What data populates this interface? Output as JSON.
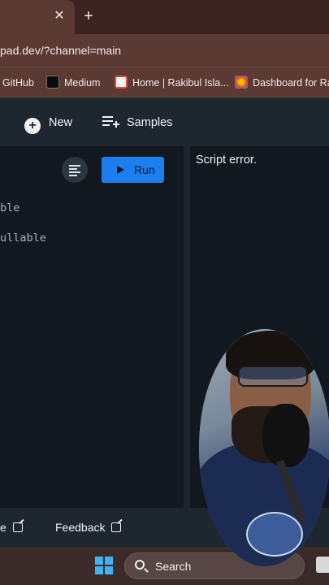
{
  "browser": {
    "tab_close": "✕",
    "new_tab": "+",
    "url": "pad.dev/?channel=main",
    "bookmarks": [
      {
        "label": "GitHub"
      },
      {
        "label": "Medium"
      },
      {
        "label": "Home | Rakibul Isla..."
      },
      {
        "label": "Dashboard for Ra"
      }
    ]
  },
  "toolbar": {
    "new_label": "New",
    "samples_label": "Samples"
  },
  "editor": {
    "run_label": "Run",
    "code_lines": [
      "ble",
      "ullable"
    ]
  },
  "output": {
    "error": "Script error."
  },
  "footer": {
    "link1": "e",
    "feedback": "Feedback"
  },
  "taskbar": {
    "search_label": "Search"
  },
  "colors": {
    "accent": "#1c7ff0",
    "chrome": "#5a3a33",
    "panel": "#111820"
  }
}
